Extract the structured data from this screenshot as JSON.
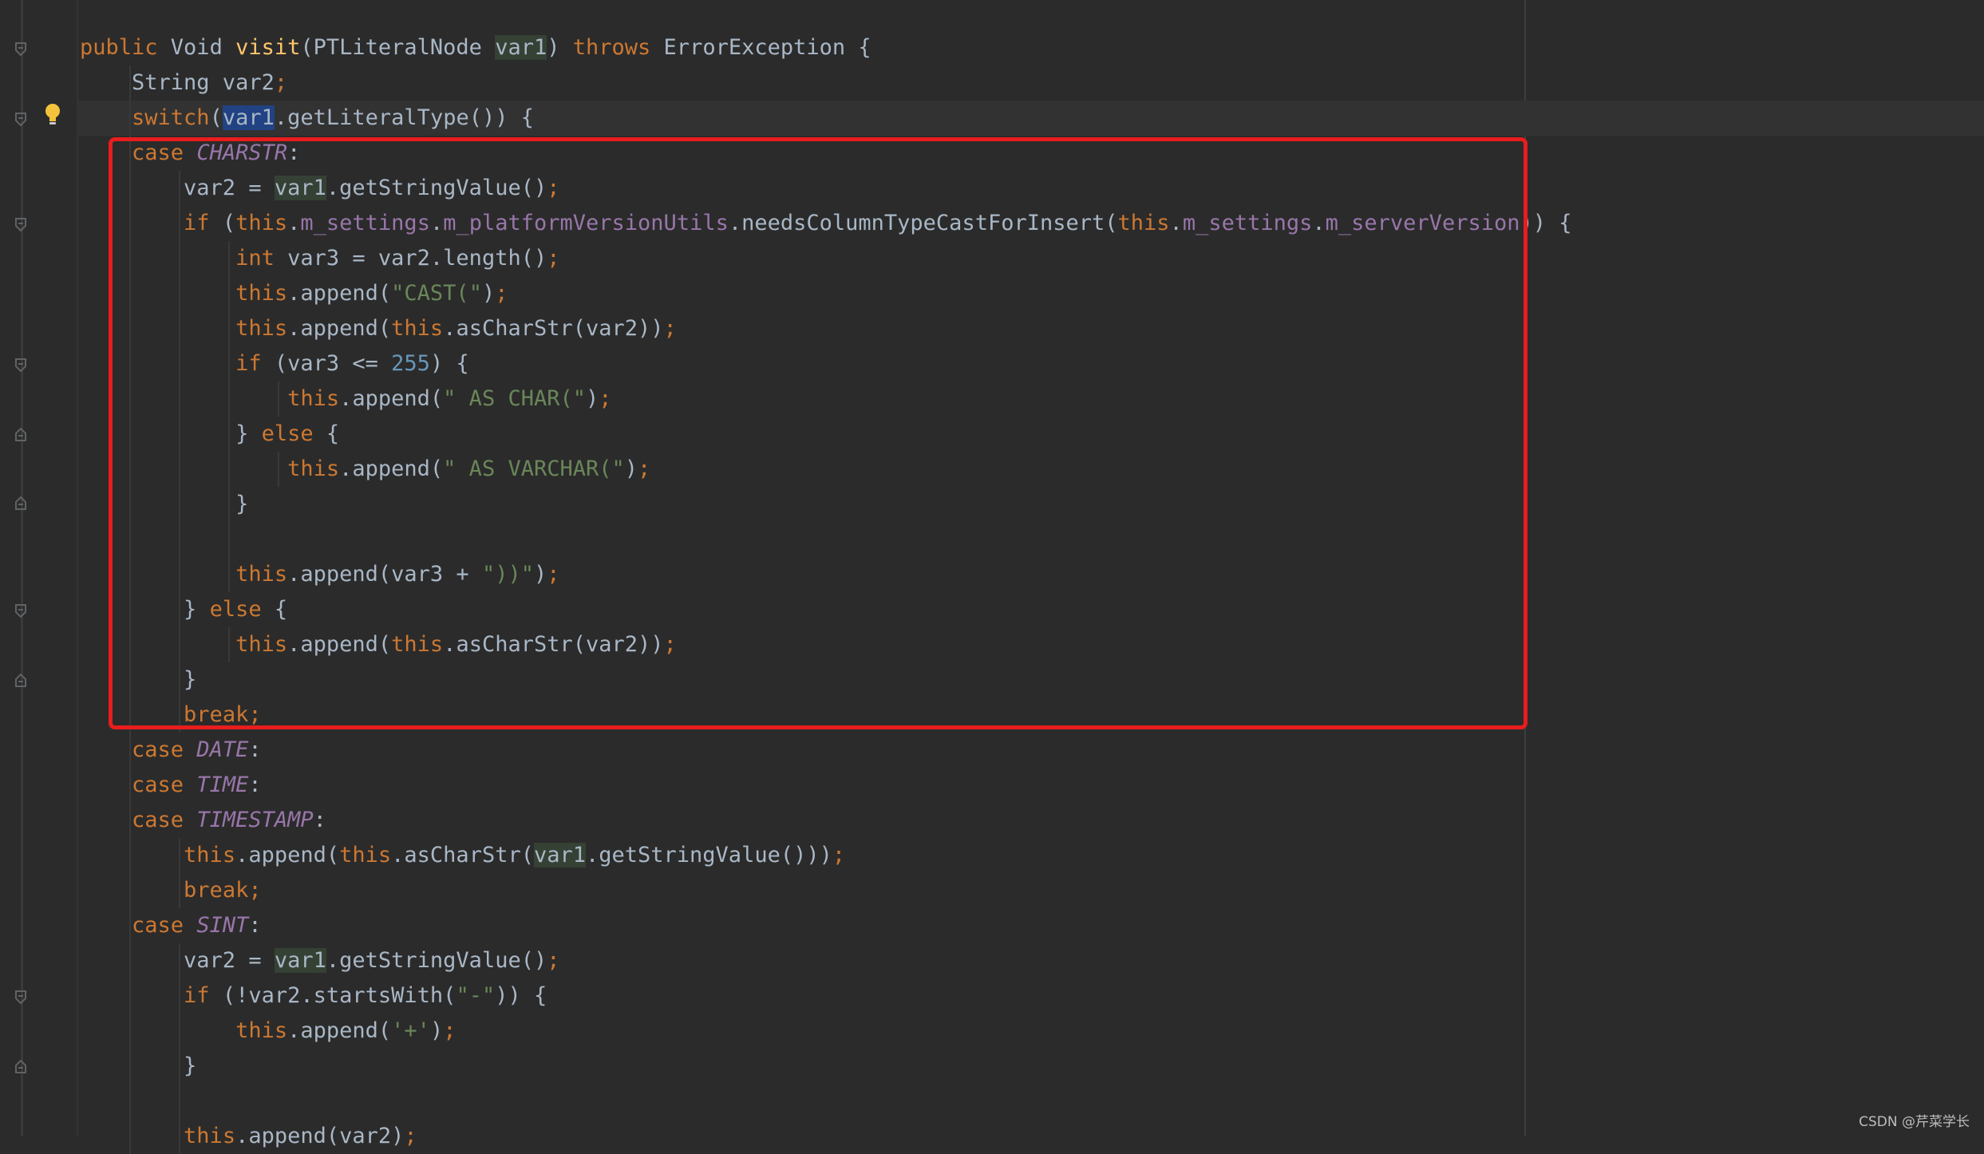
{
  "code_lines": [
    {
      "tokens": [
        {
          "t": "public ",
          "c": "kw"
        },
        {
          "t": "Void "
        },
        {
          "t": "visit",
          "c": "fn"
        },
        {
          "t": "(PTLiteralNode "
        },
        {
          "t": "var1",
          "c": "hl"
        },
        {
          "t": ") "
        },
        {
          "t": "throws",
          "c": "kw"
        },
        {
          "t": " ErrorException {"
        }
      ]
    },
    {
      "tokens": [
        {
          "t": "    String var2"
        },
        {
          "t": ";",
          "c": "kw"
        }
      ]
    },
    {
      "tokens": [
        {
          "t": "    "
        },
        {
          "t": "switch",
          "c": "kw"
        },
        {
          "t": "("
        },
        {
          "t": "var1",
          "c": "sel"
        },
        {
          "t": ".getLiteralType()) {"
        }
      ]
    },
    {
      "tokens": [
        {
          "t": "    "
        },
        {
          "t": "case ",
          "c": "kw"
        },
        {
          "t": "CHARSTR",
          "c": "enm"
        },
        {
          "t": ":"
        }
      ]
    },
    {
      "tokens": [
        {
          "t": "        var2 = "
        },
        {
          "t": "var1",
          "c": "hl"
        },
        {
          "t": ".getStringValue()"
        },
        {
          "t": ";",
          "c": "kw"
        }
      ]
    },
    {
      "tokens": [
        {
          "t": "        "
        },
        {
          "t": "if ",
          "c": "kw"
        },
        {
          "t": "("
        },
        {
          "t": "this",
          "c": "kw"
        },
        {
          "t": "."
        },
        {
          "t": "m_settings",
          "c": "fld"
        },
        {
          "t": "."
        },
        {
          "t": "m_platformVersionUtils",
          "c": "fld"
        },
        {
          "t": ".needsColumnTypeCastForInsert("
        },
        {
          "t": "this",
          "c": "kw"
        },
        {
          "t": "."
        },
        {
          "t": "m_settings",
          "c": "fld"
        },
        {
          "t": "."
        },
        {
          "t": "m_serverVersion",
          "c": "fld"
        },
        {
          "t": ")) {"
        }
      ]
    },
    {
      "tokens": [
        {
          "t": "            "
        },
        {
          "t": "int ",
          "c": "kw"
        },
        {
          "t": "var3 = var2.length()"
        },
        {
          "t": ";",
          "c": "kw"
        }
      ]
    },
    {
      "tokens": [
        {
          "t": "            "
        },
        {
          "t": "this",
          "c": "kw"
        },
        {
          "t": ".append("
        },
        {
          "t": "\"CAST(\"",
          "c": "str"
        },
        {
          "t": ")"
        },
        {
          "t": ";",
          "c": "kw"
        }
      ]
    },
    {
      "tokens": [
        {
          "t": "            "
        },
        {
          "t": "this",
          "c": "kw"
        },
        {
          "t": ".append("
        },
        {
          "t": "this",
          "c": "kw"
        },
        {
          "t": ".asCharStr(var2))"
        },
        {
          "t": ";",
          "c": "kw"
        }
      ]
    },
    {
      "tokens": [
        {
          "t": "            "
        },
        {
          "t": "if ",
          "c": "kw"
        },
        {
          "t": "(var3 <= "
        },
        {
          "t": "255",
          "c": "num"
        },
        {
          "t": ") {"
        }
      ]
    },
    {
      "tokens": [
        {
          "t": "                "
        },
        {
          "t": "this",
          "c": "kw"
        },
        {
          "t": ".append("
        },
        {
          "t": "\" AS CHAR(\"",
          "c": "str"
        },
        {
          "t": ")"
        },
        {
          "t": ";",
          "c": "kw"
        }
      ]
    },
    {
      "tokens": [
        {
          "t": "            } "
        },
        {
          "t": "else ",
          "c": "kw"
        },
        {
          "t": "{"
        }
      ]
    },
    {
      "tokens": [
        {
          "t": "                "
        },
        {
          "t": "this",
          "c": "kw"
        },
        {
          "t": ".append("
        },
        {
          "t": "\" AS VARCHAR(\"",
          "c": "str"
        },
        {
          "t": ")"
        },
        {
          "t": ";",
          "c": "kw"
        }
      ]
    },
    {
      "tokens": [
        {
          "t": "            }"
        }
      ]
    },
    {
      "tokens": [
        {
          "t": ""
        }
      ]
    },
    {
      "tokens": [
        {
          "t": "            "
        },
        {
          "t": "this",
          "c": "kw"
        },
        {
          "t": ".append(var3 + "
        },
        {
          "t": "\"))\"",
          "c": "str"
        },
        {
          "t": ")"
        },
        {
          "t": ";",
          "c": "kw"
        }
      ]
    },
    {
      "tokens": [
        {
          "t": "        } "
        },
        {
          "t": "else ",
          "c": "kw"
        },
        {
          "t": "{"
        }
      ]
    },
    {
      "tokens": [
        {
          "t": "            "
        },
        {
          "t": "this",
          "c": "kw"
        },
        {
          "t": ".append("
        },
        {
          "t": "this",
          "c": "kw"
        },
        {
          "t": ".asCharStr(var2))"
        },
        {
          "t": ";",
          "c": "kw"
        }
      ]
    },
    {
      "tokens": [
        {
          "t": "        }"
        }
      ]
    },
    {
      "tokens": [
        {
          "t": "        "
        },
        {
          "t": "break;",
          "c": "kw"
        }
      ]
    },
    {
      "tokens": [
        {
          "t": "    "
        },
        {
          "t": "case ",
          "c": "kw"
        },
        {
          "t": "DATE",
          "c": "enm"
        },
        {
          "t": ":"
        }
      ]
    },
    {
      "tokens": [
        {
          "t": "    "
        },
        {
          "t": "case ",
          "c": "kw"
        },
        {
          "t": "TIME",
          "c": "enm"
        },
        {
          "t": ":"
        }
      ]
    },
    {
      "tokens": [
        {
          "t": "    "
        },
        {
          "t": "case ",
          "c": "kw"
        },
        {
          "t": "TIMESTAMP",
          "c": "enm"
        },
        {
          "t": ":"
        }
      ]
    },
    {
      "tokens": [
        {
          "t": "        "
        },
        {
          "t": "this",
          "c": "kw"
        },
        {
          "t": ".append("
        },
        {
          "t": "this",
          "c": "kw"
        },
        {
          "t": ".asCharStr("
        },
        {
          "t": "var1",
          "c": "hl"
        },
        {
          "t": ".getStringValue()))"
        },
        {
          "t": ";",
          "c": "kw"
        }
      ]
    },
    {
      "tokens": [
        {
          "t": "        "
        },
        {
          "t": "break;",
          "c": "kw"
        }
      ]
    },
    {
      "tokens": [
        {
          "t": "    "
        },
        {
          "t": "case ",
          "c": "kw"
        },
        {
          "t": "SINT",
          "c": "enm"
        },
        {
          "t": ":"
        }
      ]
    },
    {
      "tokens": [
        {
          "t": "        var2 = "
        },
        {
          "t": "var1",
          "c": "hl"
        },
        {
          "t": ".getStringValue()"
        },
        {
          "t": ";",
          "c": "kw"
        }
      ]
    },
    {
      "tokens": [
        {
          "t": "        "
        },
        {
          "t": "if ",
          "c": "kw"
        },
        {
          "t": "(!var2.startsWith("
        },
        {
          "t": "\"-\"",
          "c": "str"
        },
        {
          "t": ")) {"
        }
      ]
    },
    {
      "tokens": [
        {
          "t": "            "
        },
        {
          "t": "this",
          "c": "kw"
        },
        {
          "t": ".append("
        },
        {
          "t": "'+'",
          "c": "str"
        },
        {
          "t": ")"
        },
        {
          "t": ";",
          "c": "kw"
        }
      ]
    },
    {
      "tokens": [
        {
          "t": "        }"
        }
      ]
    },
    {
      "tokens": [
        {
          "t": ""
        }
      ]
    },
    {
      "tokens": [
        {
          "t": "        "
        },
        {
          "t": "this",
          "c": "kw"
        },
        {
          "t": ".append(var2)"
        },
        {
          "t": ";",
          "c": "kw"
        }
      ]
    }
  ],
  "gutter": {
    "fold_markers": [
      "fold-open",
      "fold-open",
      "fold-open",
      "fold-open",
      "fold-close",
      "fold-close",
      "fold-open",
      "fold-close",
      "fold-open",
      "fold-close"
    ],
    "intention_icon": "lightbulb-icon"
  },
  "watermark": "CSDN @芹菜学长",
  "colors": {
    "background": "#2b2b2b",
    "keyword": "#cc7832",
    "method": "#ffc66d",
    "field": "#9876aa",
    "string": "#6a8759",
    "number": "#6897bb",
    "annotation_box": "#e81d1d"
  }
}
